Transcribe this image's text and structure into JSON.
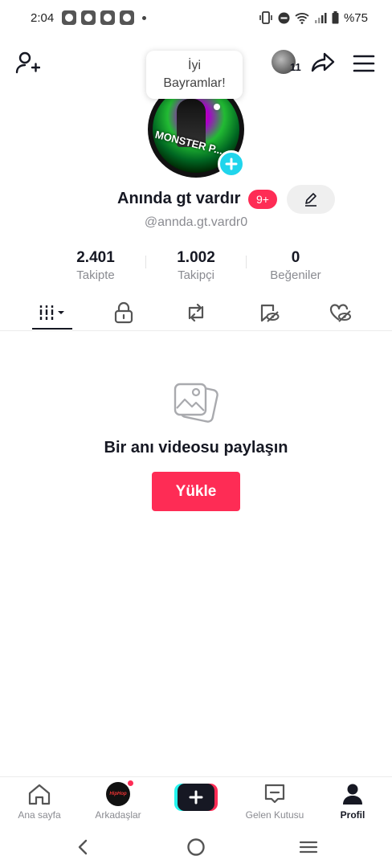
{
  "status_bar": {
    "time": "2:04",
    "battery": "%75"
  },
  "header": {
    "story_count": "11"
  },
  "bubble": {
    "line1": "İyi",
    "line2": "Bayramlar!"
  },
  "avatar": {
    "text": "MONSTER P..."
  },
  "profile": {
    "display_name": "Anında gt vardır",
    "badge": "9+",
    "username": "@annda.gt.vardr0"
  },
  "stats": [
    {
      "value": "2.401",
      "label": "Takipte"
    },
    {
      "value": "1.002",
      "label": "Takipçi"
    },
    {
      "value": "0",
      "label": "Beğeniler"
    }
  ],
  "empty": {
    "title": "Bir anı videosu paylaşın",
    "upload_label": "Yükle"
  },
  "bottom_nav": [
    {
      "label": "Ana sayfa"
    },
    {
      "label": "Arkadaşlar"
    },
    {
      "label": ""
    },
    {
      "label": "Gelen Kutusu"
    },
    {
      "label": "Profil"
    }
  ],
  "colors": {
    "accent": "#fe2c55",
    "cyan": "#20d5ec",
    "text": "#161823",
    "muted": "#8a8b91"
  }
}
